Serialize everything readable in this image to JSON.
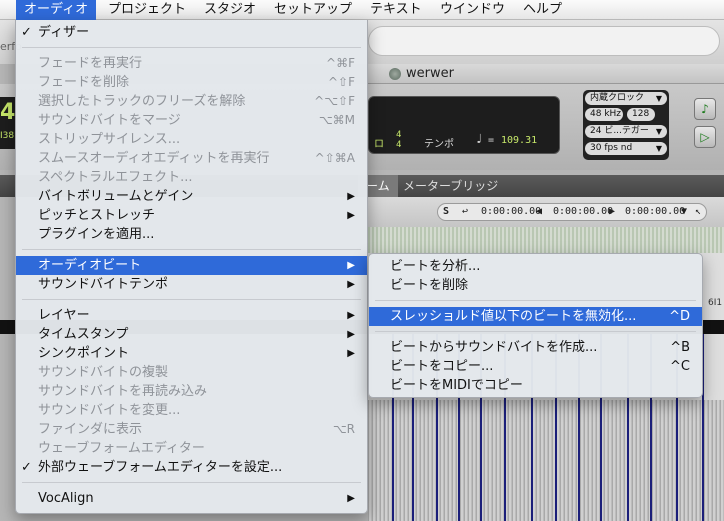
{
  "menubar": {
    "items": [
      {
        "label": "オーディオ",
        "active": true
      },
      {
        "label": "プロジェクト"
      },
      {
        "label": "スタジオ"
      },
      {
        "label": "セットアップ"
      },
      {
        "label": "テキスト"
      },
      {
        "label": "ウインドウ"
      },
      {
        "label": "ヘルプ"
      }
    ]
  },
  "background": {
    "cut_text": "erfo",
    "window_title": "werwer",
    "counter": {
      "sig_label": "ロ",
      "sig_top": "4",
      "sig_bottom": "4",
      "tempo_label": "テンポ",
      "note_symbol": "♩",
      "equals": "=",
      "tempo": "109.31"
    },
    "left_lcd_big": "4",
    "left_lcd_small": "I38",
    "sync": {
      "clock": "内蔵クロック",
      "rate": "48 kHz",
      "buffer": "128",
      "bit": "24 ビ...テガー",
      "fps": "30 fps nd"
    },
    "tabs": {
      "selected": "ーム",
      "other": "メーターブリッジ"
    },
    "clock_strip": {
      "s_label": "S",
      "time1": "0:00:00.00",
      "time2": "0:00:00.00",
      "time3": "0:00:00.00"
    },
    "ruler_label": "6I1"
  },
  "audio_menu": {
    "items": [
      {
        "label": "ディザー",
        "checked": true,
        "enabled": true
      },
      {
        "label": "フェードを再実行",
        "shortcut": "^⌘F",
        "enabled": false
      },
      {
        "label": "フェードを削除",
        "shortcut": "^⇧F",
        "enabled": false
      },
      {
        "label": "選択したトラックのフリーズを解除",
        "shortcut": "^⌥⇧F",
        "enabled": false
      },
      {
        "label": "サウンドバイトをマージ",
        "shortcut": "⌥⌘M",
        "enabled": false
      },
      {
        "label": "ストリップサイレンス...",
        "enabled": false
      },
      {
        "label": "スムースオーディオエディットを再実行",
        "shortcut": "^⇧⌘A",
        "enabled": false
      },
      {
        "label": "スペクトラルエフェクト...",
        "enabled": false
      },
      {
        "label": "バイトボリュームとゲイン",
        "submenu": true,
        "enabled": true
      },
      {
        "label": "ピッチとストレッチ",
        "submenu": true,
        "enabled": true
      },
      {
        "label": "プラグインを適用...",
        "enabled": true
      },
      {
        "label": "オーディオビート",
        "submenu": true,
        "enabled": true,
        "highlighted": true
      },
      {
        "label": "サウンドバイトテンポ",
        "submenu": true,
        "enabled": true
      },
      {
        "label": "レイヤー",
        "submenu": true,
        "enabled": true
      },
      {
        "label": "タイムスタンプ",
        "submenu": true,
        "enabled": true
      },
      {
        "label": "シンクポイント",
        "submenu": true,
        "enabled": true
      },
      {
        "label": "サウンドバイトの複製",
        "enabled": false
      },
      {
        "label": "サウンドバイトを再読み込み",
        "enabled": false
      },
      {
        "label": "サウンドバイトを変更...",
        "enabled": false
      },
      {
        "label": "ファインダに表示",
        "shortcut": "⌥R",
        "enabled": false
      },
      {
        "label": "ウェーブフォームエディター",
        "enabled": false
      },
      {
        "label": "外部ウェーブフォームエディターを設定...",
        "checked": true,
        "enabled": true
      },
      {
        "label": "VocAlign",
        "submenu": true,
        "enabled": true
      }
    ],
    "submenu_arrow": "▶",
    "check_mark": "✓"
  },
  "beat_submenu": {
    "items": [
      {
        "label": "ビートを分析...",
        "enabled": true
      },
      {
        "label": "ビートを削除",
        "enabled": true
      },
      {
        "label": "スレッショルド値以下のビートを無効化...",
        "shortcut": "^D",
        "enabled": true,
        "highlighted": true
      },
      {
        "label": "ビートからサウンドバイトを作成...",
        "shortcut": "^B",
        "enabled": true
      },
      {
        "label": "ビートをコピー...",
        "shortcut": "^C",
        "enabled": true
      },
      {
        "label": "ビートをMIDIでコピー",
        "enabled": true
      }
    ]
  },
  "colors": {
    "highlight": "#2f6ad9",
    "menu_bg": "#e4e8ec",
    "disabled_text": "#8f9399",
    "lcd_green": "#c7e86a"
  }
}
